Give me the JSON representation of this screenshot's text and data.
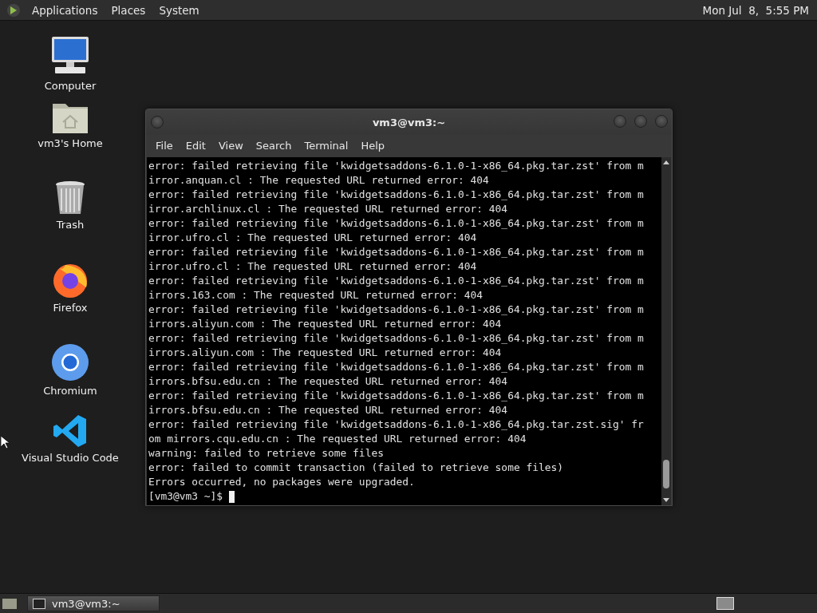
{
  "top_panel": {
    "menus": [
      "Applications",
      "Places",
      "System"
    ],
    "clock": "Mon Jul  8,  5:55 PM"
  },
  "desktop_icons": [
    {
      "kind": "computer",
      "label": "Computer"
    },
    {
      "kind": "home",
      "label": "vm3's Home"
    },
    {
      "kind": "trash",
      "label": "Trash"
    },
    {
      "kind": "firefox",
      "label": "Firefox"
    },
    {
      "kind": "chromium",
      "label": "Chromium"
    },
    {
      "kind": "vscode",
      "label": "Visual Studio Code"
    }
  ],
  "terminal_window": {
    "title": "vm3@vm3:~",
    "menu": [
      "File",
      "Edit",
      "View",
      "Search",
      "Terminal",
      "Help"
    ],
    "lines": [
      "error: failed retrieving file 'kwidgetsaddons-6.1.0-1-x86_64.pkg.tar.zst' from m",
      "irror.anquan.cl : The requested URL returned error: 404",
      "error: failed retrieving file 'kwidgetsaddons-6.1.0-1-x86_64.pkg.tar.zst' from m",
      "irror.archlinux.cl : The requested URL returned error: 404",
      "error: failed retrieving file 'kwidgetsaddons-6.1.0-1-x86_64.pkg.tar.zst' from m",
      "irror.ufro.cl : The requested URL returned error: 404",
      "error: failed retrieving file 'kwidgetsaddons-6.1.0-1-x86_64.pkg.tar.zst' from m",
      "irror.ufro.cl : The requested URL returned error: 404",
      "error: failed retrieving file 'kwidgetsaddons-6.1.0-1-x86_64.pkg.tar.zst' from m",
      "irrors.163.com : The requested URL returned error: 404",
      "error: failed retrieving file 'kwidgetsaddons-6.1.0-1-x86_64.pkg.tar.zst' from m",
      "irrors.aliyun.com : The requested URL returned error: 404",
      "error: failed retrieving file 'kwidgetsaddons-6.1.0-1-x86_64.pkg.tar.zst' from m",
      "irrors.aliyun.com : The requested URL returned error: 404",
      "error: failed retrieving file 'kwidgetsaddons-6.1.0-1-x86_64.pkg.tar.zst' from m",
      "irrors.bfsu.edu.cn : The requested URL returned error: 404",
      "error: failed retrieving file 'kwidgetsaddons-6.1.0-1-x86_64.pkg.tar.zst' from m",
      "irrors.bfsu.edu.cn : The requested URL returned error: 404",
      "error: failed retrieving file 'kwidgetsaddons-6.1.0-1-x86_64.pkg.tar.zst.sig' fr",
      "om mirrors.cqu.edu.cn : The requested URL returned error: 404",
      "warning: failed to retrieve some files",
      "error: failed to commit transaction (failed to retrieve some files)",
      "Errors occurred, no packages were upgraded."
    ],
    "prompt": "[vm3@vm3 ~]$",
    "cursor_visible": true
  },
  "taskbar": {
    "tasks": [
      {
        "label": "vm3@vm3:~",
        "selected": true
      }
    ]
  }
}
